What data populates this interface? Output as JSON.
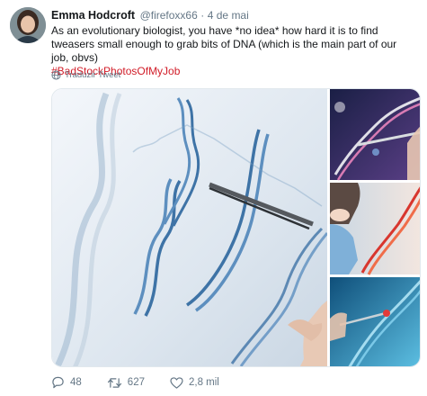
{
  "tweet": {
    "author_name": "Emma Hodcroft",
    "handle": "@firefoxx66",
    "separator": "·",
    "time": "4 de mai",
    "text": "As an evolutionary biologist, you have *no idea* how hard it is to find tweasers small enough to grab bits of DNA (which is the main part of our job, obvs)",
    "hashtag": "#BadStockPhotosOfMyJob",
    "translate_label": "Traduzir Tweet"
  },
  "actions": {
    "replies": "48",
    "retweets": "627",
    "likes": "2,8 mil"
  },
  "colors": {
    "hashtag": "#d11c28",
    "secondary_text": "#657786",
    "dna_blue": "#4a7fb0"
  },
  "icons": [
    "globe-icon",
    "reply-icon",
    "retweet-icon",
    "like-icon"
  ]
}
